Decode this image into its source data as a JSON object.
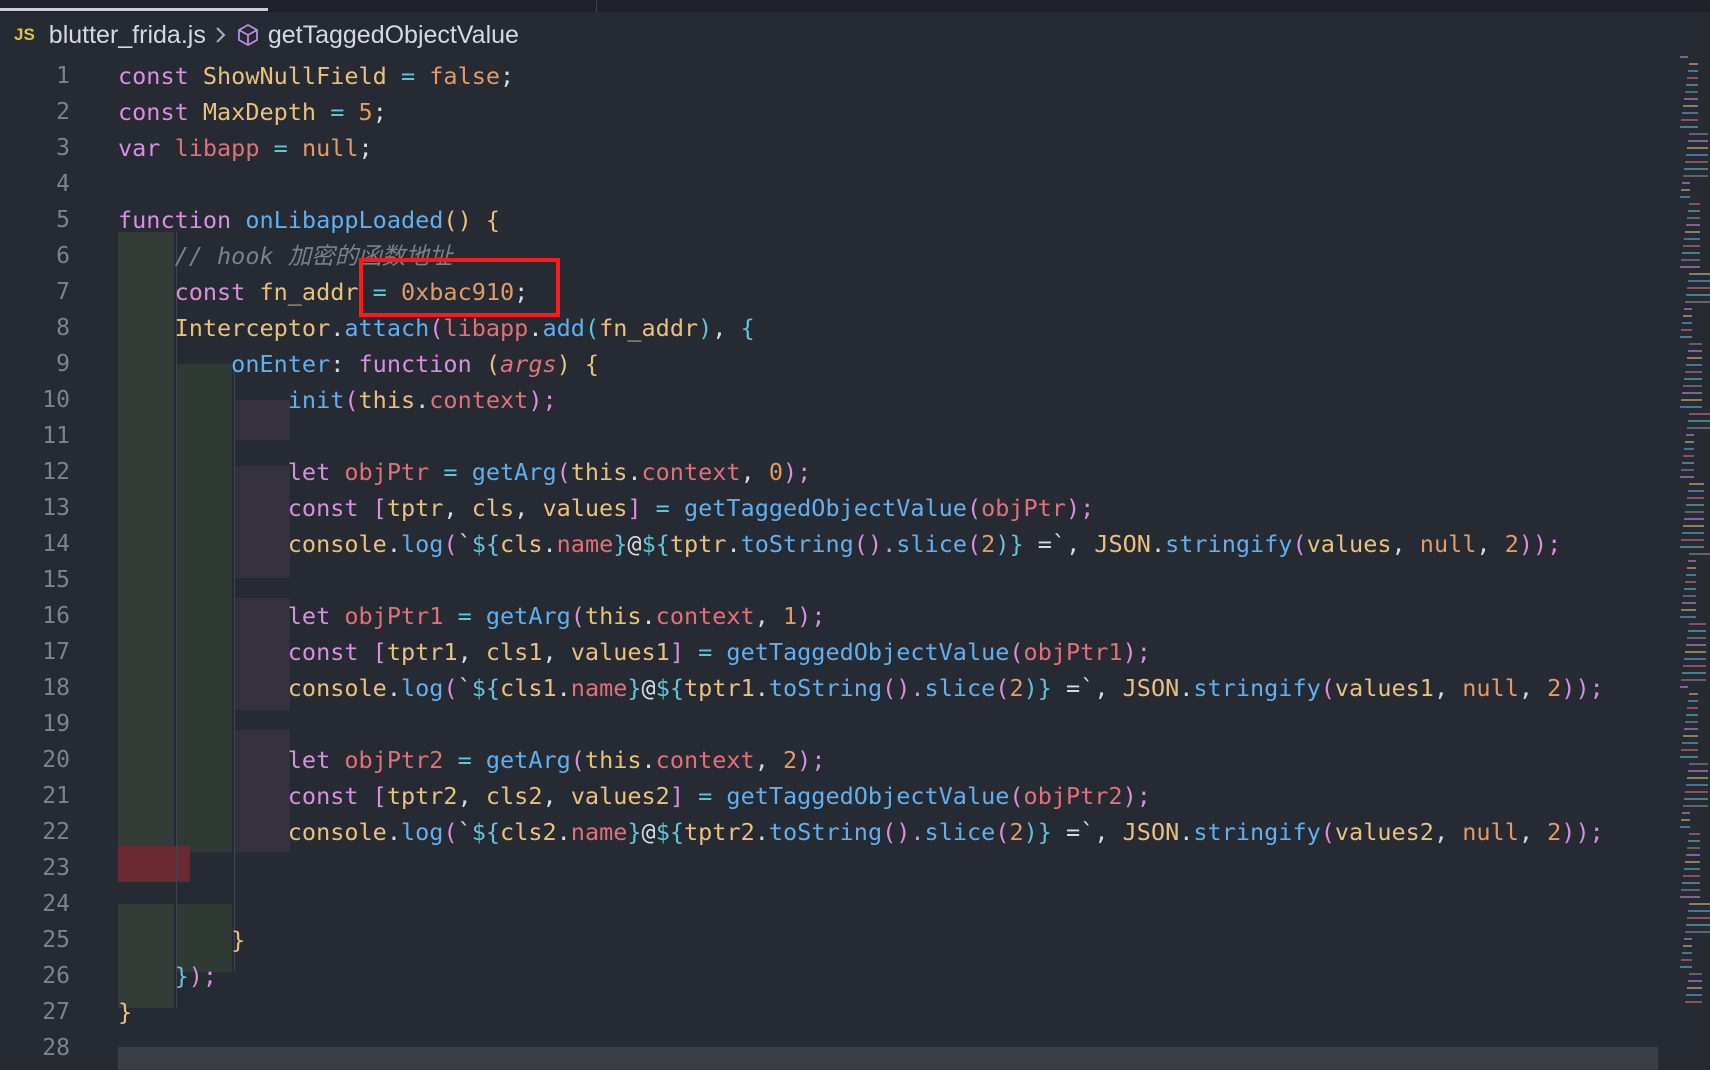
{
  "breadcrumb": {
    "file_icon": "JS",
    "file": "blutter_frida.js",
    "separator_icon": "chevron-right-icon",
    "symbol_icon": "cube-icon",
    "symbol": "getTaggedObjectValue"
  },
  "code": {
    "lines": [
      {
        "n": "1",
        "parts": [
          {
            "t": "const ",
            "c": "kw"
          },
          {
            "t": "ShowNullField",
            "c": "cl"
          },
          {
            "t": " = ",
            "c": "op"
          },
          {
            "t": "false",
            "c": "bool"
          },
          {
            "t": ";",
            "c": ""
          }
        ]
      },
      {
        "n": "2",
        "parts": [
          {
            "t": "const ",
            "c": "kw"
          },
          {
            "t": "MaxDepth",
            "c": "cl"
          },
          {
            "t": " = ",
            "c": "op"
          },
          {
            "t": "5",
            "c": "bool"
          },
          {
            "t": ";",
            "c": ""
          }
        ]
      },
      {
        "n": "3",
        "parts": [
          {
            "t": "var ",
            "c": "kw"
          },
          {
            "t": "libapp",
            "c": "var"
          },
          {
            "t": " = ",
            "c": "op"
          },
          {
            "t": "null",
            "c": "bool"
          },
          {
            "t": ";",
            "c": ""
          }
        ]
      },
      {
        "n": "4",
        "parts": []
      },
      {
        "n": "5",
        "parts": [
          {
            "t": "function ",
            "c": "kw"
          },
          {
            "t": "onLibappLoaded",
            "c": "fn"
          },
          {
            "t": "() {",
            "c": "br"
          }
        ]
      },
      {
        "n": "6",
        "parts": [
          {
            "t": "    // hook 加密的函数地址",
            "c": "cmt"
          }
        ]
      },
      {
        "n": "7",
        "parts": [
          {
            "t": "    const ",
            "c": "kw"
          },
          {
            "t": "fn_addr",
            "c": "cl"
          },
          {
            "t": " = ",
            "c": "op"
          },
          {
            "t": "0xbac910",
            "c": "bool"
          },
          {
            "t": ";",
            "c": ""
          }
        ]
      },
      {
        "n": "8",
        "parts": [
          {
            "t": "    Interceptor",
            "c": "cl"
          },
          {
            "t": ".",
            "c": ""
          },
          {
            "t": "attach",
            "c": "fn"
          },
          {
            "t": "(",
            "c": "kw"
          },
          {
            "t": "libapp",
            "c": "var"
          },
          {
            "t": ".",
            "c": ""
          },
          {
            "t": "add",
            "c": "fn"
          },
          {
            "t": "(",
            "c": "br2"
          },
          {
            "t": "fn_addr",
            "c": "cl"
          },
          {
            "t": ")",
            "c": "br2"
          },
          {
            "t": ", ",
            "c": ""
          },
          {
            "t": "{",
            "c": "br2"
          }
        ]
      },
      {
        "n": "9",
        "parts": [
          {
            "t": "        onEnter",
            "c": "fn"
          },
          {
            "t": ": ",
            "c": ""
          },
          {
            "t": "function ",
            "c": "kw"
          },
          {
            "t": "(",
            "c": "br"
          },
          {
            "t": "args",
            "c": "prm"
          },
          {
            "t": ") {",
            "c": "br"
          }
        ]
      },
      {
        "n": "10",
        "parts": [
          {
            "t": "            init",
            "c": "fn"
          },
          {
            "t": "(",
            "c": "kw"
          },
          {
            "t": "this",
            "c": "cl"
          },
          {
            "t": ".",
            "c": ""
          },
          {
            "t": "context",
            "c": "var"
          },
          {
            "t": ");",
            "c": "kw"
          }
        ]
      },
      {
        "n": "11",
        "parts": []
      },
      {
        "n": "12",
        "parts": [
          {
            "t": "            let ",
            "c": "kw"
          },
          {
            "t": "objPtr",
            "c": "var"
          },
          {
            "t": " = ",
            "c": "op"
          },
          {
            "t": "getArg",
            "c": "fn"
          },
          {
            "t": "(",
            "c": "kw"
          },
          {
            "t": "this",
            "c": "cl"
          },
          {
            "t": ".",
            "c": ""
          },
          {
            "t": "context",
            "c": "var"
          },
          {
            "t": ", ",
            "c": ""
          },
          {
            "t": "0",
            "c": "bool"
          },
          {
            "t": ");",
            "c": "kw"
          }
        ]
      },
      {
        "n": "13",
        "parts": [
          {
            "t": "            const ",
            "c": "kw"
          },
          {
            "t": "[",
            "c": "kw"
          },
          {
            "t": "tptr",
            "c": "cl"
          },
          {
            "t": ", ",
            "c": ""
          },
          {
            "t": "cls",
            "c": "cl"
          },
          {
            "t": ", ",
            "c": ""
          },
          {
            "t": "values",
            "c": "cl"
          },
          {
            "t": "]",
            "c": "kw"
          },
          {
            "t": " = ",
            "c": "op"
          },
          {
            "t": "getTaggedObjectValue",
            "c": "fn"
          },
          {
            "t": "(",
            "c": "kw"
          },
          {
            "t": "objPtr",
            "c": "var"
          },
          {
            "t": ");",
            "c": "kw"
          }
        ]
      },
      {
        "n": "14",
        "parts": [
          {
            "t": "            console",
            "c": "cl"
          },
          {
            "t": ".",
            "c": ""
          },
          {
            "t": "log",
            "c": "fn"
          },
          {
            "t": "(",
            "c": "kw"
          },
          {
            "t": "`",
            "c": ""
          },
          {
            "t": "${",
            "c": "op"
          },
          {
            "t": "cls",
            "c": "cl"
          },
          {
            "t": ".",
            "c": ""
          },
          {
            "t": "name",
            "c": "var"
          },
          {
            "t": "}",
            "c": "op"
          },
          {
            "t": "@",
            "c": ""
          },
          {
            "t": "${",
            "c": "op"
          },
          {
            "t": "tptr",
            "c": "cl"
          },
          {
            "t": ".",
            "c": ""
          },
          {
            "t": "toString",
            "c": "fn"
          },
          {
            "t": "().",
            "c": "kw"
          },
          {
            "t": "slice",
            "c": "fn"
          },
          {
            "t": "(",
            "c": "kw"
          },
          {
            "t": "2",
            "c": "bool"
          },
          {
            "t": ")}",
            "c": "op"
          },
          {
            "t": " =`",
            "c": ""
          },
          {
            "t": ", ",
            "c": ""
          },
          {
            "t": "JSON",
            "c": "cl"
          },
          {
            "t": ".",
            "c": ""
          },
          {
            "t": "stringify",
            "c": "fn"
          },
          {
            "t": "(",
            "c": "kw"
          },
          {
            "t": "values",
            "c": "cl"
          },
          {
            "t": ", ",
            "c": ""
          },
          {
            "t": "null",
            "c": "bool"
          },
          {
            "t": ", ",
            "c": ""
          },
          {
            "t": "2",
            "c": "bool"
          },
          {
            "t": "));",
            "c": "kw"
          }
        ]
      },
      {
        "n": "15",
        "parts": []
      },
      {
        "n": "16",
        "parts": [
          {
            "t": "            let ",
            "c": "kw"
          },
          {
            "t": "objPtr1",
            "c": "var"
          },
          {
            "t": " = ",
            "c": "op"
          },
          {
            "t": "getArg",
            "c": "fn"
          },
          {
            "t": "(",
            "c": "kw"
          },
          {
            "t": "this",
            "c": "cl"
          },
          {
            "t": ".",
            "c": ""
          },
          {
            "t": "context",
            "c": "var"
          },
          {
            "t": ", ",
            "c": ""
          },
          {
            "t": "1",
            "c": "bool"
          },
          {
            "t": ");",
            "c": "kw"
          }
        ]
      },
      {
        "n": "17",
        "parts": [
          {
            "t": "            const ",
            "c": "kw"
          },
          {
            "t": "[",
            "c": "kw"
          },
          {
            "t": "tptr1",
            "c": "cl"
          },
          {
            "t": ", ",
            "c": ""
          },
          {
            "t": "cls1",
            "c": "cl"
          },
          {
            "t": ", ",
            "c": ""
          },
          {
            "t": "values1",
            "c": "cl"
          },
          {
            "t": "]",
            "c": "kw"
          },
          {
            "t": " = ",
            "c": "op"
          },
          {
            "t": "getTaggedObjectValue",
            "c": "fn"
          },
          {
            "t": "(",
            "c": "kw"
          },
          {
            "t": "objPtr1",
            "c": "var"
          },
          {
            "t": ");",
            "c": "kw"
          }
        ]
      },
      {
        "n": "18",
        "parts": [
          {
            "t": "            console",
            "c": "cl"
          },
          {
            "t": ".",
            "c": ""
          },
          {
            "t": "log",
            "c": "fn"
          },
          {
            "t": "(",
            "c": "kw"
          },
          {
            "t": "`",
            "c": ""
          },
          {
            "t": "${",
            "c": "op"
          },
          {
            "t": "cls1",
            "c": "cl"
          },
          {
            "t": ".",
            "c": ""
          },
          {
            "t": "name",
            "c": "var"
          },
          {
            "t": "}",
            "c": "op"
          },
          {
            "t": "@",
            "c": ""
          },
          {
            "t": "${",
            "c": "op"
          },
          {
            "t": "tptr1",
            "c": "cl"
          },
          {
            "t": ".",
            "c": ""
          },
          {
            "t": "toString",
            "c": "fn"
          },
          {
            "t": "().",
            "c": "kw"
          },
          {
            "t": "slice",
            "c": "fn"
          },
          {
            "t": "(",
            "c": "kw"
          },
          {
            "t": "2",
            "c": "bool"
          },
          {
            "t": ")}",
            "c": "op"
          },
          {
            "t": " =`",
            "c": ""
          },
          {
            "t": ", ",
            "c": ""
          },
          {
            "t": "JSON",
            "c": "cl"
          },
          {
            "t": ".",
            "c": ""
          },
          {
            "t": "stringify",
            "c": "fn"
          },
          {
            "t": "(",
            "c": "kw"
          },
          {
            "t": "values1",
            "c": "cl"
          },
          {
            "t": ", ",
            "c": ""
          },
          {
            "t": "null",
            "c": "bool"
          },
          {
            "t": ", ",
            "c": ""
          },
          {
            "t": "2",
            "c": "bool"
          },
          {
            "t": "));",
            "c": "kw"
          }
        ]
      },
      {
        "n": "19",
        "parts": []
      },
      {
        "n": "20",
        "parts": [
          {
            "t": "            let ",
            "c": "kw"
          },
          {
            "t": "objPtr2",
            "c": "var"
          },
          {
            "t": " = ",
            "c": "op"
          },
          {
            "t": "getArg",
            "c": "fn"
          },
          {
            "t": "(",
            "c": "kw"
          },
          {
            "t": "this",
            "c": "cl"
          },
          {
            "t": ".",
            "c": ""
          },
          {
            "t": "context",
            "c": "var"
          },
          {
            "t": ", ",
            "c": ""
          },
          {
            "t": "2",
            "c": "bool"
          },
          {
            "t": ");",
            "c": "kw"
          }
        ]
      },
      {
        "n": "21",
        "parts": [
          {
            "t": "            const ",
            "c": "kw"
          },
          {
            "t": "[",
            "c": "kw"
          },
          {
            "t": "tptr2",
            "c": "cl"
          },
          {
            "t": ", ",
            "c": ""
          },
          {
            "t": "cls2",
            "c": "cl"
          },
          {
            "t": ", ",
            "c": ""
          },
          {
            "t": "values2",
            "c": "cl"
          },
          {
            "t": "]",
            "c": "kw"
          },
          {
            "t": " = ",
            "c": "op"
          },
          {
            "t": "getTaggedObjectValue",
            "c": "fn"
          },
          {
            "t": "(",
            "c": "kw"
          },
          {
            "t": "objPtr2",
            "c": "var"
          },
          {
            "t": ");",
            "c": "kw"
          }
        ]
      },
      {
        "n": "22",
        "parts": [
          {
            "t": "            console",
            "c": "cl"
          },
          {
            "t": ".",
            "c": ""
          },
          {
            "t": "log",
            "c": "fn"
          },
          {
            "t": "(",
            "c": "kw"
          },
          {
            "t": "`",
            "c": ""
          },
          {
            "t": "${",
            "c": "op"
          },
          {
            "t": "cls2",
            "c": "cl"
          },
          {
            "t": ".",
            "c": ""
          },
          {
            "t": "name",
            "c": "var"
          },
          {
            "t": "}",
            "c": "op"
          },
          {
            "t": "@",
            "c": ""
          },
          {
            "t": "${",
            "c": "op"
          },
          {
            "t": "tptr2",
            "c": "cl"
          },
          {
            "t": ".",
            "c": ""
          },
          {
            "t": "toString",
            "c": "fn"
          },
          {
            "t": "().",
            "c": "kw"
          },
          {
            "t": "slice",
            "c": "fn"
          },
          {
            "t": "(",
            "c": "kw"
          },
          {
            "t": "2",
            "c": "bool"
          },
          {
            "t": ")}",
            "c": "op"
          },
          {
            "t": " =`",
            "c": ""
          },
          {
            "t": ", ",
            "c": ""
          },
          {
            "t": "JSON",
            "c": "cl"
          },
          {
            "t": ".",
            "c": ""
          },
          {
            "t": "stringify",
            "c": "fn"
          },
          {
            "t": "(",
            "c": "kw"
          },
          {
            "t": "values2",
            "c": "cl"
          },
          {
            "t": ", ",
            "c": ""
          },
          {
            "t": "null",
            "c": "bool"
          },
          {
            "t": ", ",
            "c": ""
          },
          {
            "t": "2",
            "c": "bool"
          },
          {
            "t": "));",
            "c": "kw"
          }
        ]
      },
      {
        "n": "23",
        "parts": []
      },
      {
        "n": "24",
        "parts": []
      },
      {
        "n": "25",
        "parts": [
          {
            "t": "        }",
            "c": "br"
          }
        ]
      },
      {
        "n": "26",
        "parts": [
          {
            "t": "    }",
            "c": "br2"
          },
          {
            "t": ");",
            "c": "kw"
          }
        ]
      },
      {
        "n": "27",
        "parts": [
          {
            "t": "}",
            "c": "br"
          }
        ]
      },
      {
        "n": "28",
        "parts": []
      }
    ]
  },
  "colors": {
    "background": "#262a33",
    "keyword": "#d98ee0",
    "class": "#e8c27a",
    "function": "#61afef",
    "variable": "#e17078",
    "number": "#e39a63",
    "operator": "#5ec6d6",
    "comment": "#7a808c",
    "highlight_box": "#ff1a1a"
  }
}
